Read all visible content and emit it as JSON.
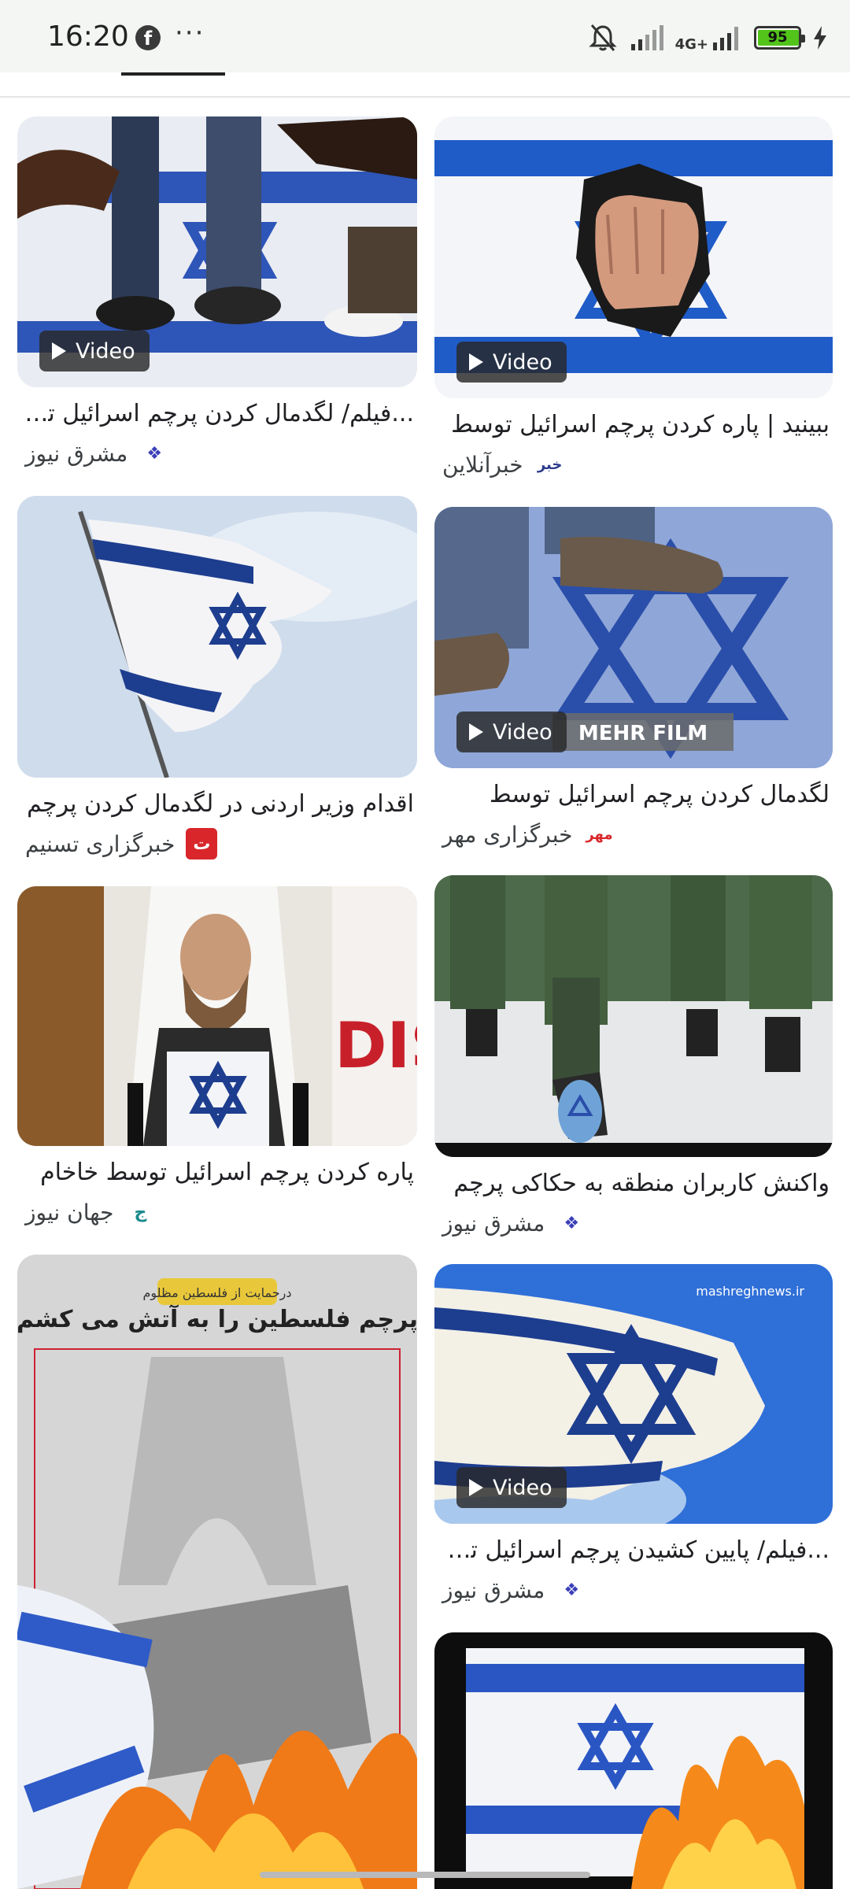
{
  "status_bar": {
    "time": "16:20",
    "facebook_icon": "f",
    "more_icon": "···",
    "network": "4G+",
    "battery": "95",
    "icons": [
      "mute-bell-icon",
      "signal-icon",
      "network-4g-icon",
      "battery-icon",
      "charging-icon"
    ]
  },
  "video_label": "Video",
  "cards": [
    {
      "title": "...فیلم/ لگدمال کردن پرچم اسرائیل توس",
      "source": "مشرق نیوز",
      "logo": "❖",
      "logo_color": "#3b3fb8",
      "has_video": true
    },
    {
      "title": "ببینید | پاره کردن پرچم اسرائیل توسط",
      "source": "خبرآنلاین",
      "logo": "خبر",
      "logo_color": "#2b3a8c",
      "has_video": true
    },
    {
      "title": "اقدام وزیر اردنی در لگدمال کردن پرچم",
      "source": "خبرگزاری تسنیم",
      "logo": "ت",
      "logo_color": "#d8262b",
      "has_video": false
    },
    {
      "title": "لگدمال کردن پرچم اسرائیل توسط",
      "source": "خبرگزاری مهر",
      "logo": "مهر",
      "logo_color": "#d8262b",
      "has_video": true
    },
    {
      "title": "پاره کردن پرچم اسرائیل توسط خاخام",
      "source": "جهان نیوز",
      "logo": "ج",
      "logo_color": "#1a8a8c",
      "has_video": false
    },
    {
      "title": "واکنش کاربران منطقه به حکاکی پرچم",
      "source": "مشرق نیوز",
      "logo": "❖",
      "logo_color": "#3b3fb8",
      "has_video": false
    },
    {
      "title": "",
      "source": "",
      "logo": "",
      "logo_color": "",
      "has_video": false
    },
    {
      "title": "...فیلم/ پایین کشیدن پرچم اسرائیل توس",
      "source": "مشرق نیوز",
      "logo": "❖",
      "logo_color": "#3b3fb8",
      "has_video": true
    },
    {
      "title": "",
      "source": "",
      "logo": "",
      "logo_color": "",
      "has_video": false
    }
  ],
  "image_text": {
    "card4_overlay": "MEHR FILM",
    "card7_headline": "پرچم فلسطین را به آتش می کشم",
    "card7_banner": "درحمایت از فلسطین مظلوم",
    "card8_watermark": "mashreghnews.ir"
  }
}
